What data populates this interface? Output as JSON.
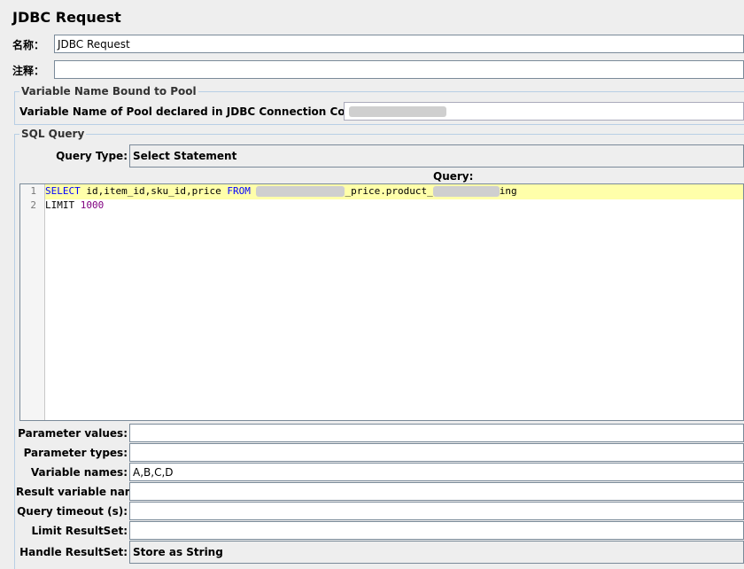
{
  "window": {
    "title": "JDBC Request"
  },
  "name_field": {
    "label": "名称：",
    "value": "JDBC Request"
  },
  "comment_field": {
    "label": "注释：",
    "value": ""
  },
  "pool_group": {
    "legend": "Variable Name Bound to Pool",
    "label": "Variable Name of Pool declared in JDBC Connection Configuratio",
    "value": ""
  },
  "sql_group": {
    "legend": "SQL Query",
    "query_type_label": "Query Type:",
    "query_type_value": "Select Statement",
    "query_label": "Query:"
  },
  "editor": {
    "line_numbers": [
      "1",
      "2"
    ],
    "line1": {
      "keyword1": "SELECT",
      "cols": " id,item_id,sku_id,price ",
      "keyword2": "FROM",
      "part1": "_price.product_",
      "part2": "ing"
    },
    "line2": {
      "text": "LIMIT ",
      "number": "1000"
    }
  },
  "params": {
    "parameter_values": {
      "label": "Parameter values:",
      "value": ""
    },
    "parameter_types": {
      "label": "Parameter types:",
      "value": ""
    },
    "variable_names": {
      "label": "Variable names:",
      "value": "A,B,C,D"
    },
    "result_variable_name": {
      "label": "Result variable name:",
      "value": ""
    },
    "query_timeout": {
      "label": "Query timeout (s):",
      "value": ""
    },
    "limit_resultset": {
      "label": "Limit ResultSet:",
      "value": ""
    },
    "handle_resultset": {
      "label": "Handle ResultSet:",
      "value": "Store as String"
    }
  },
  "colors": {
    "current_line": "#ffffaa",
    "keyword": "#0000ff",
    "number": "#800080"
  }
}
